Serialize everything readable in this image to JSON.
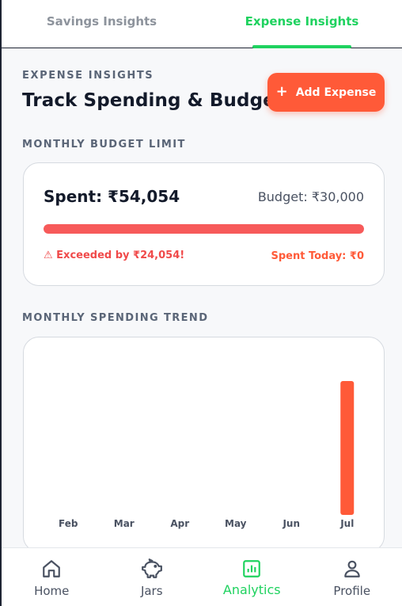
{
  "tabs": [
    {
      "label": "Savings Insights",
      "active": false
    },
    {
      "label": "Expense Insights",
      "active": true
    }
  ],
  "header": {
    "eyebrow": "EXPENSE INSIGHTS",
    "title": "Track Spending & Budget",
    "add_button_label": "Add Expense",
    "add_button_icon": "plus-icon"
  },
  "budget_section": {
    "label": "MONTHLY BUDGET LIMIT",
    "spent": "Spent: ₹54,054",
    "budget": "Budget: ₹30,000",
    "progress_fraction": 1.0,
    "exceeded": "⚠ Exceeded by ₹24,054!",
    "spent_today": "Spent Today: ₹0"
  },
  "trend_section": {
    "label": "MONTHLY SPENDING TREND"
  },
  "chart_data": {
    "type": "bar",
    "categories": [
      "Feb",
      "Mar",
      "Apr",
      "May",
      "Jun",
      "Jul"
    ],
    "values": [
      0,
      0,
      0,
      0,
      0,
      54054
    ],
    "title": "",
    "xlabel": "",
    "ylabel": "",
    "ylim": [
      0,
      54054
    ],
    "grid": false,
    "bar_color": "#ff5a38"
  },
  "bottom_nav": [
    {
      "label": "Home",
      "icon": "home-icon",
      "active": false
    },
    {
      "label": "Jars",
      "icon": "piggy-bank-icon",
      "active": false
    },
    {
      "label": "Analytics",
      "icon": "analytics-icon",
      "active": true
    },
    {
      "label": "Profile",
      "icon": "profile-icon",
      "active": false
    }
  ],
  "colors": {
    "accent_green": "#1fd25f",
    "accent_orange": "#ff5a38",
    "danger_red": "#f04a4a"
  }
}
